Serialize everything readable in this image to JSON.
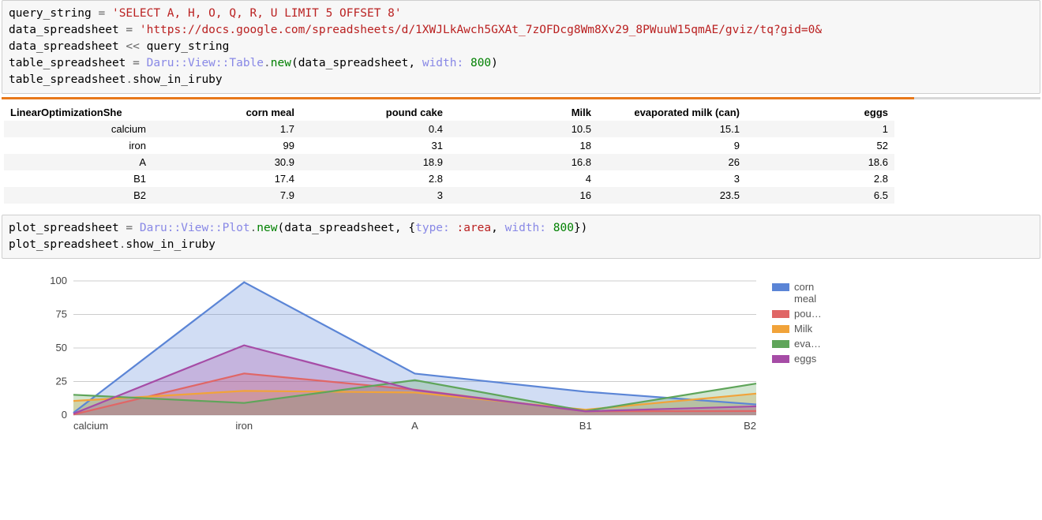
{
  "code1": {
    "line1_a": "query_string ",
    "line1_op": "=",
    "line1_str": " 'SELECT A, H, O, Q, R, U LIMIT 5 OFFSET 8'",
    "line2_a": "data_spreadsheet ",
    "line2_op": "=",
    "line2_str": " 'https://docs.google.com/spreadsheets/d/1XWJLkAwch5GXAt_7zOFDcg8Wm8Xv29_8PWuuW15qmAE/gviz/tq?gid=0&",
    "line3_a": "data_spreadsheet ",
    "line3_op": "<<",
    "line3_b": " query_string",
    "line4_a": "table_spreadsheet ",
    "line4_op": "=",
    "line4_ns": " Daru::View::",
    "line4_cls": "Table",
    "line4_dot": ".",
    "line4_fn": "new",
    "line4_args_a": "(data_spreadsheet, ",
    "line4_kw": "width:",
    "line4_num": " 800",
    "line4_close": ")",
    "line5_a": "table_spreadsheet",
    "line5_dot": ".",
    "line5_fn": "show_in_iruby"
  },
  "code2": {
    "line1_a": "plot_spreadsheet ",
    "line1_op": "=",
    "line1_ns": " Daru::View::",
    "line1_cls": "Plot",
    "line1_fn": "new",
    "line1_args_a": "(data_spreadsheet, {",
    "line1_kw1": "type:",
    "line1_sym": " :area",
    "line1_comma": ", ",
    "line1_kw2": "width:",
    "line1_num": " 800",
    "line1_close": "})",
    "line2_a": "plot_spreadsheet",
    "line2_fn": "show_in_iruby"
  },
  "table": {
    "headers": [
      "LinearOptimizationShe",
      "corn meal",
      "pound cake",
      "Milk",
      "evaporated milk (can)",
      "eggs"
    ],
    "rows": [
      [
        "calcium",
        "1.7",
        "0.4",
        "10.5",
        "15.1",
        "1"
      ],
      [
        "iron",
        "99",
        "31",
        "18",
        "9",
        "52"
      ],
      [
        "A",
        "30.9",
        "18.9",
        "16.8",
        "26",
        "18.6"
      ],
      [
        "B1",
        "17.4",
        "2.8",
        "4",
        "3",
        "2.8"
      ],
      [
        "B2",
        "7.9",
        "3",
        "16",
        "23.5",
        "6.5"
      ]
    ]
  },
  "chart_data": {
    "type": "area",
    "categories": [
      "calcium",
      "iron",
      "A",
      "B1",
      "B2"
    ],
    "series": [
      {
        "name": "corn meal",
        "color": "#5b85d6",
        "values": [
          1.7,
          99,
          30.9,
          17.4,
          7.9
        ]
      },
      {
        "name": "pou…",
        "color": "#e06666",
        "values": [
          0.4,
          31,
          18.9,
          2.8,
          3
        ]
      },
      {
        "name": "Milk",
        "color": "#f1a33a",
        "values": [
          10.5,
          18,
          16.8,
          4,
          16
        ]
      },
      {
        "name": "eva…",
        "color": "#5fa55a",
        "values": [
          15.1,
          9,
          26,
          3,
          23.5
        ]
      },
      {
        "name": "eggs",
        "color": "#a64ca6",
        "values": [
          1,
          52,
          18.6,
          2.8,
          6.5
        ]
      }
    ],
    "ylim": [
      0,
      100
    ],
    "yticks": [
      0,
      25,
      50,
      75,
      100
    ],
    "title": "",
    "xlabel": "",
    "ylabel": ""
  }
}
